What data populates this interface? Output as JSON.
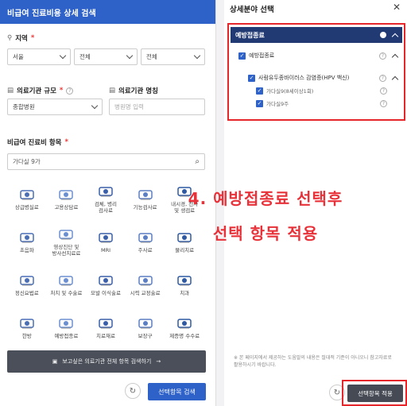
{
  "left": {
    "title": "비급여 진료비용 상세 검색",
    "region": {
      "label": "지역",
      "required": "*",
      "selects": [
        "서울",
        "전체",
        "전체"
      ]
    },
    "scale": {
      "label": "의료기관 규모",
      "required": "*",
      "value": "종합병원"
    },
    "name": {
      "label": "의료기관 명칭",
      "placeholder": "병원명 입력"
    },
    "items": {
      "label": "비급여 진료비 항목",
      "required": "*",
      "search": "가다실 9가"
    },
    "grid": [
      "상급병실료",
      "고용상담료",
      "검체, 병리\n검사료",
      "기능검사료",
      "내시경, 천자\n및 생검료",
      "초음파",
      "영상진단 및\n방사선치료료",
      "MRI",
      "주사료",
      "물리치료",
      "정신요법료",
      "처치 및 수술료",
      "모발 이식술료",
      "시력 교정술료",
      "치과",
      "한방",
      "예방접종료",
      "치료재료",
      "보장구",
      "제증명 수수료"
    ],
    "help_bar": "보고싶은 의료기관 전체 항목 검색하기",
    "search_button": "선택항목 검색"
  },
  "right": {
    "title": "상세분야 선택",
    "tree_header": "예방접종료",
    "row1": "예방접종료",
    "row2": "사람유두종바이러스 감염증(HPV 백신)",
    "row3": "가다실9(8세이상1회)",
    "row4": "가다실9주",
    "notice": "※ 본 페이지에서 제공하는 도움말의 내용은 절대적 기준이 아니오니 참고자료로 활용하시기 바랍니다.",
    "apply_button": "선택항목 적용"
  },
  "overlay": {
    "line1": "4. 예방접종료 선택후",
    "line2": "선택 항목 적용"
  },
  "colors": {
    "brand": "#2e62c9",
    "highlight": "#e5262a",
    "tree_header": "#213a74"
  }
}
